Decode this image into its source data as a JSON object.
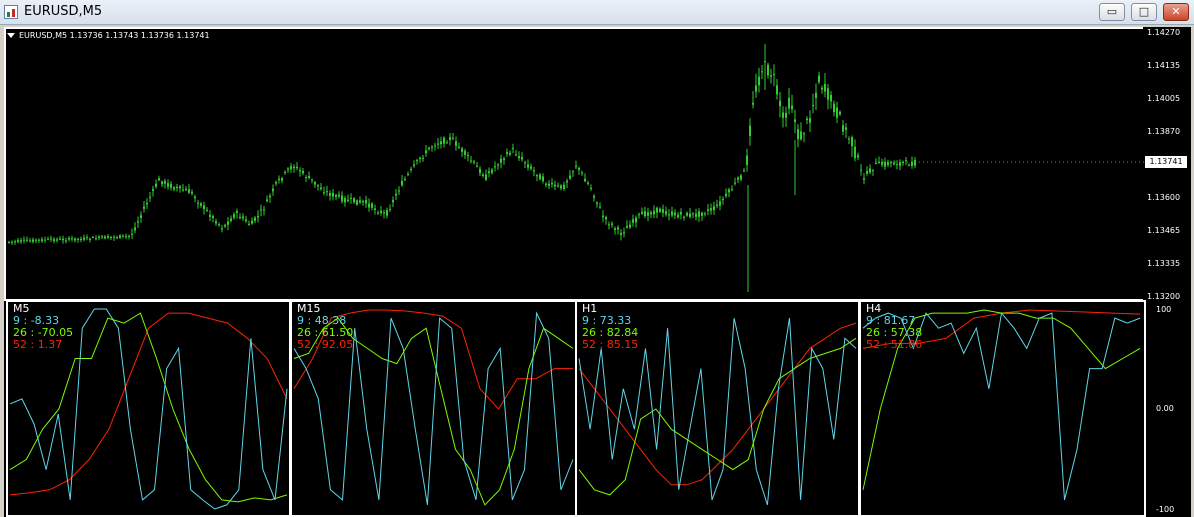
{
  "window": {
    "title": "EURUSD,M5",
    "buttons": {
      "minimize": "▭",
      "maximize": "□",
      "close": "✕"
    }
  },
  "chart": {
    "header": "EURUSD,M5  1.13736 1.13743 1.13736 1.13741",
    "price_axis": [
      "1.14270",
      "1.14135",
      "1.14005",
      "1.13870",
      "1.13741",
      "1.13600",
      "1.13465",
      "1.13335",
      "1.13200"
    ],
    "current_price": "1.13741",
    "colors": {
      "candle": "#32cd32",
      "background": "#000000",
      "axis_text": "#ffffff"
    }
  },
  "indicator": {
    "axis": [
      "100",
      "0.00",
      "-100"
    ],
    "colors": {
      "fast": "#5fd7e8",
      "medium": "#7cfc00",
      "slow": "#ff2200"
    },
    "panels": [
      {
        "timeframe": "M5",
        "fast": "9 : -8.33",
        "medium": "26 : -70.05",
        "slow": "52 : 1.37"
      },
      {
        "timeframe": "M15",
        "fast": "9 : 48.38",
        "medium": "26 : 61.50",
        "slow": "52 : 92.05"
      },
      {
        "timeframe": "H1",
        "fast": "9 : 73.33",
        "medium": "26 : 82.84",
        "slow": "52 : 85.15"
      },
      {
        "timeframe": "H4",
        "fast": "9 : 81.67",
        "medium": "26 : 57.38",
        "slow": "52 : 51.86"
      }
    ]
  }
}
